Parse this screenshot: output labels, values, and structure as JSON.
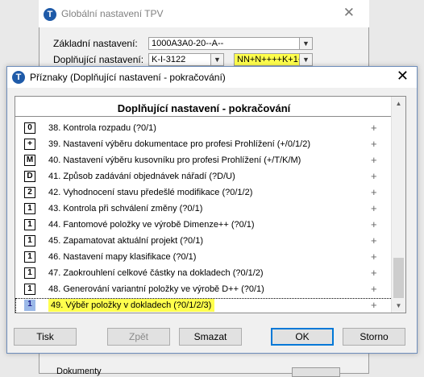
{
  "background_window": {
    "title": "Globální nastavení TPV",
    "basic_label": "Základní nastavení:",
    "basic_value": "1000A3A0-20--A--",
    "extra_label": "Doplňující nastavení:",
    "extra_value": "K-I-3122",
    "extra_code": "NN+N++++K+1+",
    "bottom_text": "Dokumenty"
  },
  "dialog": {
    "title": "Příznaky (Doplňující nastavení - pokračování)",
    "list_header": "Doplňující nastavení - pokračování",
    "rows": [
      {
        "flag": "0",
        "text": "38.  Kontrola rozpadu (?0/1)",
        "mark": "+"
      },
      {
        "flag": "+",
        "text": "39.  Nastavení výběru dokumentace pro profesi Prohlížení (+/0/1/2)",
        "mark": "+"
      },
      {
        "flag": "M",
        "text": "40.  Nastavení výběru kusovníku pro profesi Prohlížení (+/T/K/M)",
        "mark": "+"
      },
      {
        "flag": "D",
        "text": "41.  Způsob zadávání objednávek nářadí (?D/U)",
        "mark": "+"
      },
      {
        "flag": "2",
        "text": "42.  Vyhodnocení stavu předešlé modifikace (?0/1/2)",
        "mark": "+"
      },
      {
        "flag": "1",
        "text": "43.  Kontrola při schválení změny (?0/1)",
        "mark": "+"
      },
      {
        "flag": "1",
        "text": "44.  Fantomové položky ve výrobě Dimenze++ (?0/1)",
        "mark": "+"
      },
      {
        "flag": "1",
        "text": "45.  Zapamatovat aktuální projekt (?0/1)",
        "mark": "+"
      },
      {
        "flag": "1",
        "text": "46.  Nastavení mapy klasifikace (?0/1)",
        "mark": "+"
      },
      {
        "flag": "1",
        "text": "47.  Zaokrouhlení celkové částky na dokladech (?0/1/2)",
        "mark": "+"
      },
      {
        "flag": "1",
        "text": "48.  Generování variantní položky ve výrobě D++ (?0/1)",
        "mark": "+"
      },
      {
        "flag": "1",
        "text": "49.  Výběr položky v dokladech (?0/1/2/3)",
        "mark": "+"
      }
    ],
    "buttons": {
      "print": "Tisk",
      "back": "Zpět",
      "delete": "Smazat",
      "ok": "OK",
      "cancel": "Storno"
    }
  },
  "colors": {
    "highlight": "#ffff4d",
    "accent": "#0078d7"
  }
}
